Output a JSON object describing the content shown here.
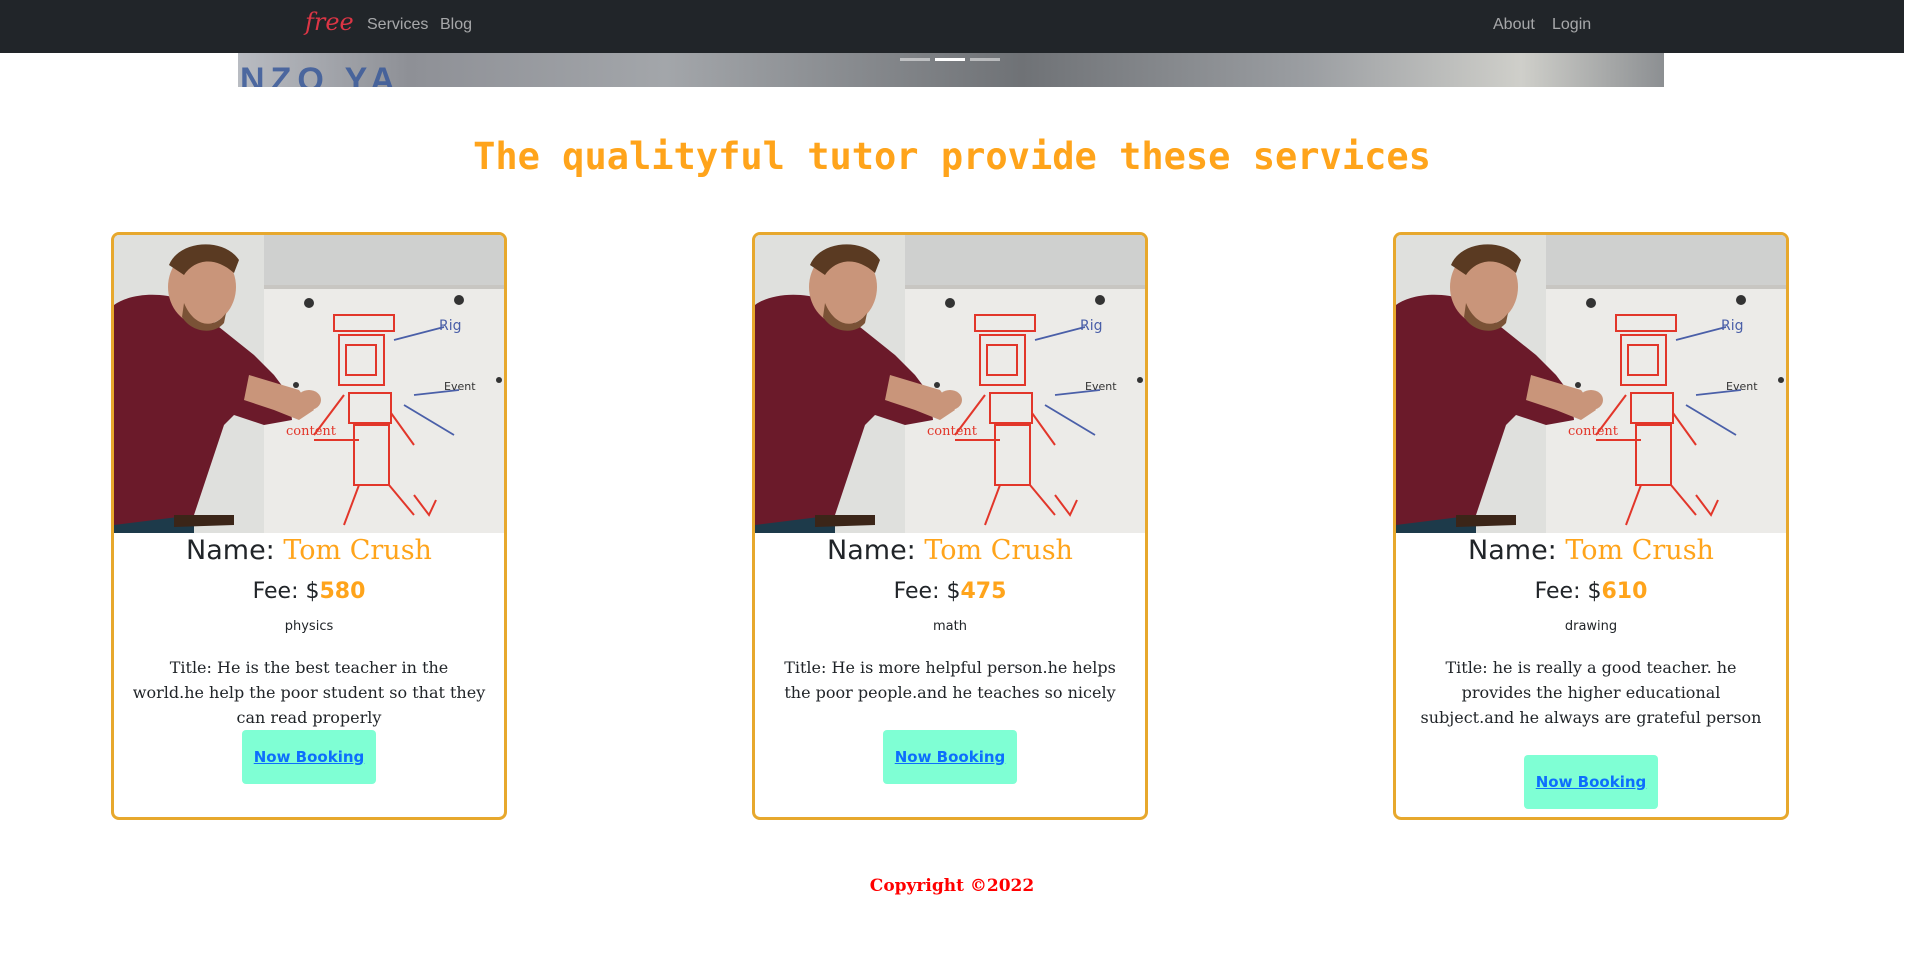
{
  "navbar": {
    "brand": "free",
    "left_links": [
      "Services",
      "Blog"
    ],
    "right_links": [
      "About",
      "Login"
    ]
  },
  "banner": {
    "partial_text": "NZO YA",
    "indicators": 3,
    "active_indicator": 1
  },
  "section": {
    "heading": "The qualityful tutor provide these services"
  },
  "cards": [
    {
      "name_label": "Name:",
      "name": "Tom Crush",
      "fee_label": "Fee: $",
      "fee": "580",
      "subject": "physics",
      "description": "Title: He is the best teacher in the world.he help the poor student so that they can read properly",
      "button": "Now Booking"
    },
    {
      "name_label": "Name:",
      "name": "Tom Crush",
      "fee_label": "Fee: $",
      "fee": "475",
      "subject": "math",
      "description": "Title: He is more helpful person.he helps the poor people.and he teaches so nicely",
      "button": "Now Booking"
    },
    {
      "name_label": "Name:",
      "name": "Tom Crush",
      "fee_label": "Fee: $",
      "fee": "610",
      "subject": "drawing",
      "description": "Title: he is really a good teacher. he provides the higher educational subject.and he always are grateful person",
      "button": "Now Booking"
    }
  ],
  "footer": {
    "copyright": "Copyright ©2022"
  },
  "colors": {
    "navbar_bg": "#212529",
    "accent_orange": "#ffa41b",
    "card_border": "#e7a82d",
    "button_bg": "#7fffd4",
    "button_text": "#0d6efd",
    "brand_red": "#dc3545",
    "copyright_red": "#ff0000"
  }
}
